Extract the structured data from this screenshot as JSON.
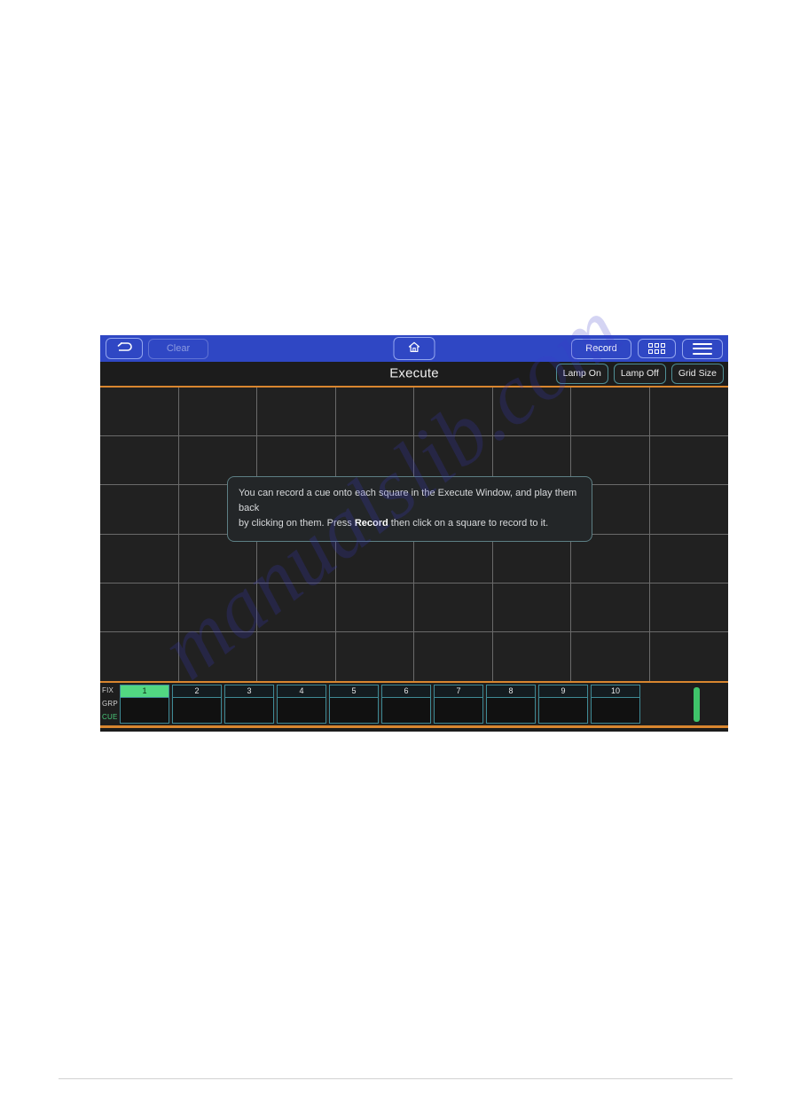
{
  "toolbar": {
    "back_icon": "back-arrow-icon",
    "clear_label": "Clear",
    "home_icon": "home-icon",
    "record_label": "Record",
    "apps_icon": "app-grid-icon",
    "menu_icon": "hamburger-menu-icon"
  },
  "titlebar": {
    "title": "Execute",
    "lamp_on_label": "Lamp On",
    "lamp_off_label": "Lamp Off",
    "grid_size_label": "Grid Size"
  },
  "hint": {
    "line1_a": "You can record a cue onto each square in the Execute Window, and play them back",
    "line2_a": "by clicking on them. Press ",
    "line2_bold": "Record",
    "line2_b": " then click on a square to record to it."
  },
  "grid": {
    "columns": 8,
    "rows": 6
  },
  "bottom_bar": {
    "side_labels": [
      "FIX",
      "GRP",
      "CUE"
    ],
    "cues": [
      "1",
      "2",
      "3",
      "4",
      "5",
      "6",
      "7",
      "8",
      "9",
      "10"
    ],
    "active_cue": "1"
  },
  "watermark": {
    "text": "manualslib.com"
  },
  "colors": {
    "toolbar_blue": "#2f47c4",
    "accent_orange": "#d9862f",
    "teal_border": "#4f8f95",
    "active_green": "#52d782",
    "fader_green": "#3fc46a",
    "panel_dark": "#1c1c1c"
  }
}
